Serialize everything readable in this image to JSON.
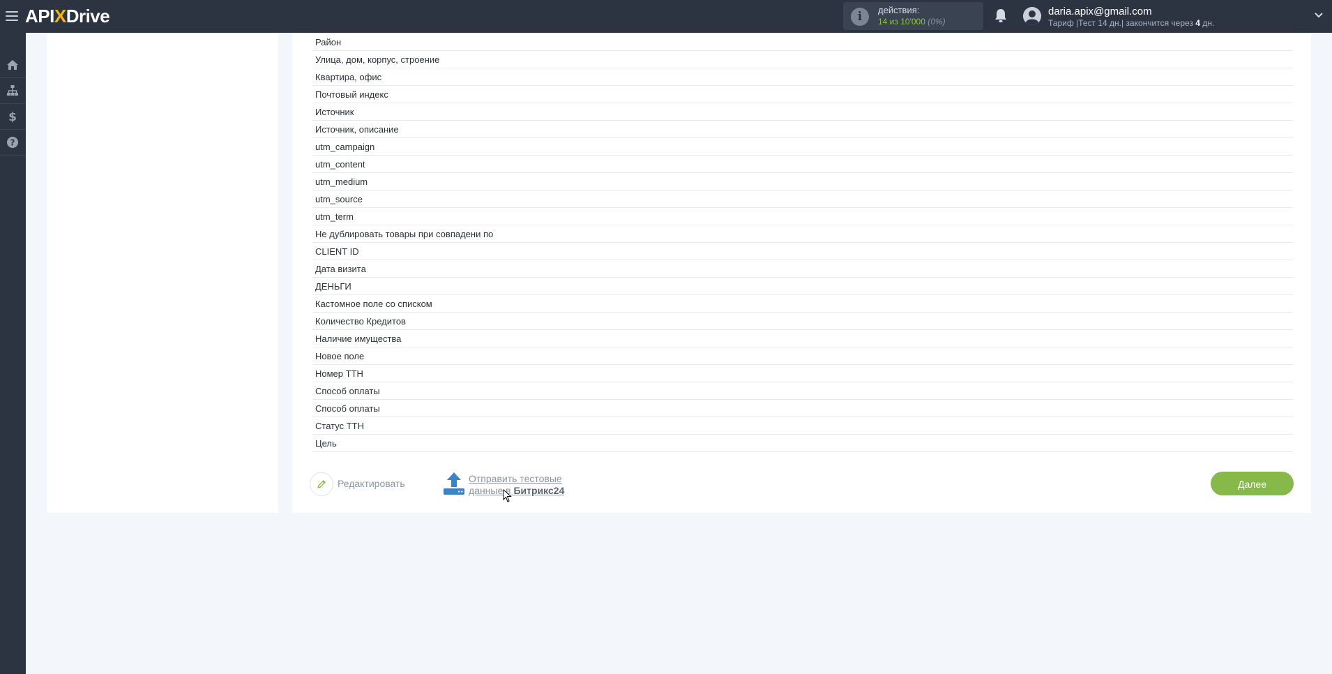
{
  "header": {
    "logo_prefix": "API",
    "logo_x": "X",
    "logo_suffix": "Drive",
    "actions_label": "действия:",
    "actions_used": "14 из 10'000",
    "actions_percent": "(0%)",
    "user_email": "daria.apix@gmail.com",
    "tariff_prefix": "Тариф |Тест 14 дн.| закончится через",
    "tariff_days": "4",
    "tariff_suffix": "дн."
  },
  "fields": [
    "Район",
    "Улица, дом, корпус, строение",
    "Квартира, офис",
    "Почтовый индекс",
    "Источник",
    "Источник, описание",
    "utm_campaign",
    "utm_content",
    "utm_medium",
    "utm_source",
    "utm_term",
    "Не дублировать товары при совпадени по",
    "CLIENT ID",
    "Дата визита",
    "ДЕНЬГИ",
    "Кастомное поле со списком",
    "Количество Кредитов",
    "Наличие имущества",
    "Новое поле",
    "Номер ТТН",
    "Способ оплаты",
    "Способ оплаты",
    "Статус ТТН",
    "Цель"
  ],
  "footer": {
    "edit_label": "Редактировать",
    "send_line1": "Отправить тестовые",
    "send_line2": "данные в",
    "send_target": "Битрикс24",
    "next_label": "Далее"
  },
  "colors": {
    "topbar": "#2c3441",
    "accent_green": "#86b84a",
    "upload_blue": "#3d83c4"
  },
  "icons": {
    "menu": "burger-menu-icon",
    "info": "info-icon",
    "notifications": "bell-icon",
    "user": "user-avatar-icon",
    "sidebar": [
      "home-icon",
      "sitemap-icon",
      "dollar-icon",
      "help-icon"
    ],
    "edit": "pencil-icon",
    "send": "upload-icon"
  }
}
